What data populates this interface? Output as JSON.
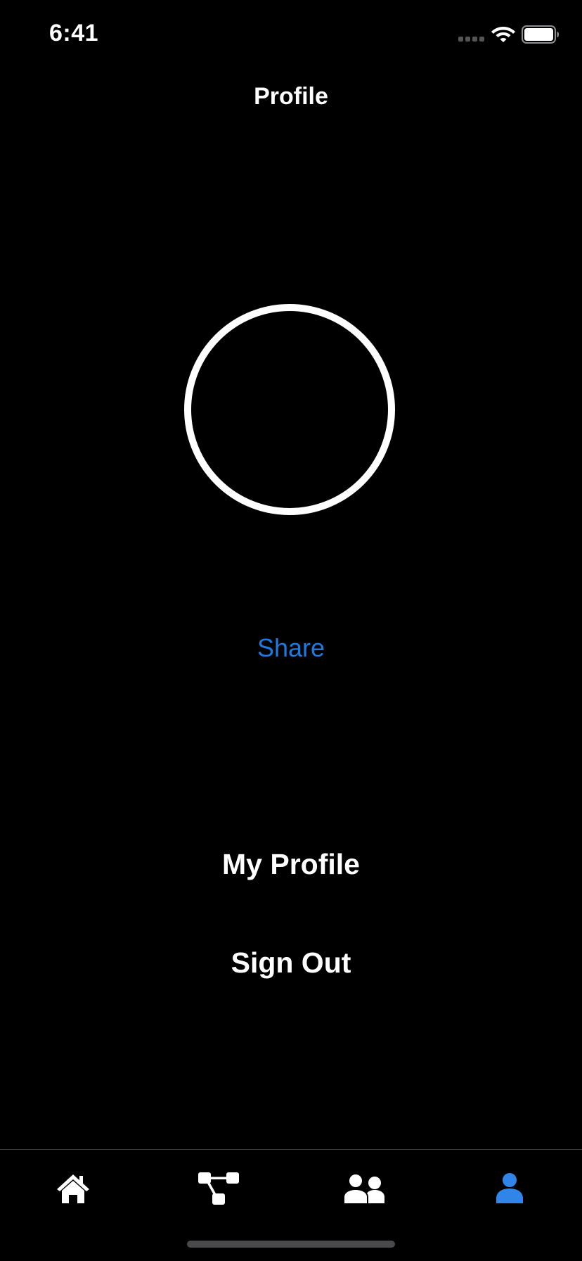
{
  "status_bar": {
    "time": "6:41",
    "signal_icon": "signal-dots-icon",
    "wifi_icon": "wifi-icon",
    "battery_icon": "battery-full-icon"
  },
  "nav": {
    "title": "Profile"
  },
  "avatar": {
    "icon": "avatar-placeholder-ring"
  },
  "share": {
    "label": "Share",
    "color": "#1f7ae0"
  },
  "actions": {
    "my_profile_label": "My Profile",
    "sign_out_label": "Sign Out"
  },
  "tab_bar": {
    "tabs": [
      {
        "icon": "home-icon",
        "active": false
      },
      {
        "icon": "workflow-icon",
        "active": false
      },
      {
        "icon": "people-icon",
        "active": false
      },
      {
        "icon": "person-icon",
        "active": true
      }
    ],
    "active_color": "#2f86e8",
    "inactive_color": "#ffffff"
  }
}
